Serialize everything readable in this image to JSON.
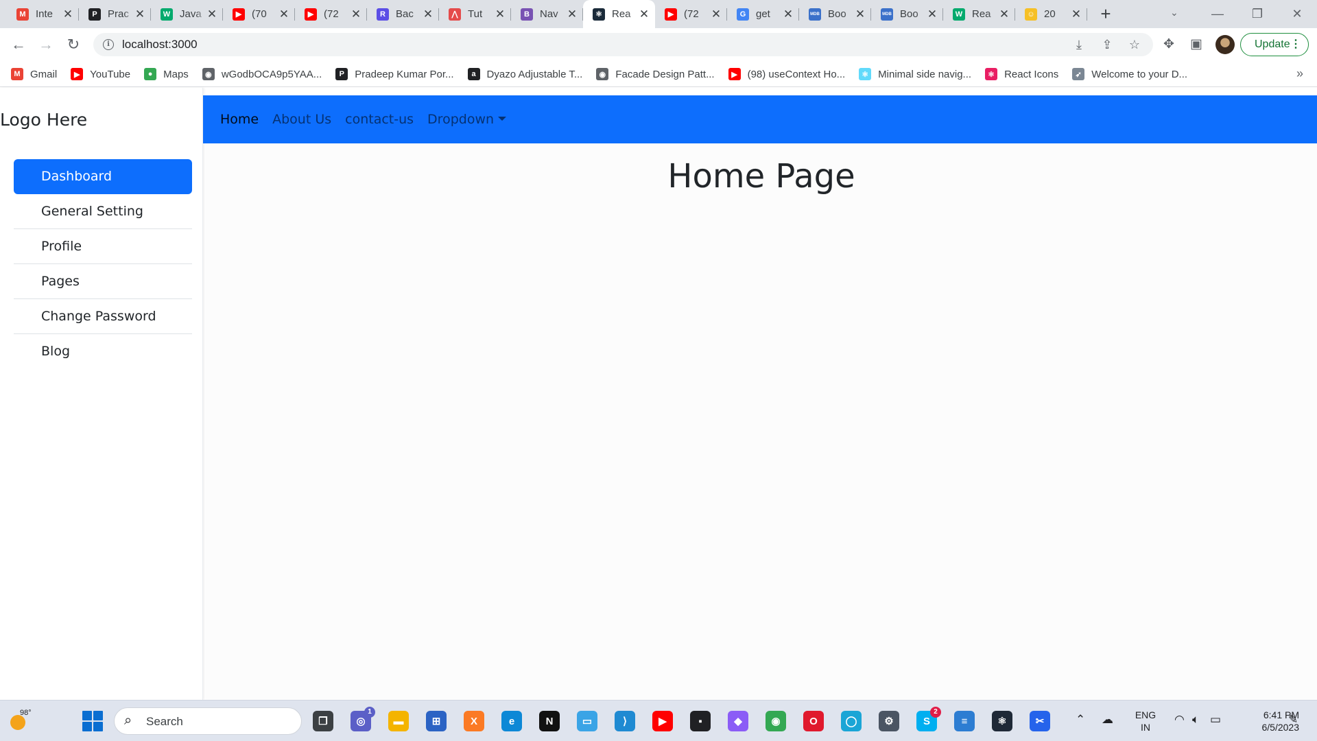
{
  "browser": {
    "tabs": [
      {
        "title": "Inte",
        "icon": "gmail-icon",
        "fav": "M",
        "color": "#ea4335",
        "active": false
      },
      {
        "title": "Prac",
        "icon": "p-logo-icon",
        "fav": "P",
        "color": "#202124",
        "active": false
      },
      {
        "title": "Java",
        "icon": "w3schools-icon",
        "fav": "W",
        "color": "#04aa6d",
        "active": false
      },
      {
        "title": "(70",
        "icon": "youtube-icon",
        "fav": "▶",
        "color": "#ff0000",
        "active": false
      },
      {
        "title": "(72",
        "icon": "youtube-icon",
        "fav": "▶",
        "color": "#ff0000",
        "active": false
      },
      {
        "title": "Bac",
        "icon": "r-app-icon",
        "fav": "R",
        "color": "#5b4ee6",
        "active": false
      },
      {
        "title": "Tut",
        "icon": "tutorial-icon",
        "fav": "⋀",
        "color": "#e54b4b",
        "active": false
      },
      {
        "title": "Nav",
        "icon": "bootstrap-icon",
        "fav": "B",
        "color": "#7952b3",
        "active": false
      },
      {
        "title": "Rea",
        "icon": "react-icon",
        "fav": "⚛",
        "color": "#1b2b3a",
        "active": true
      },
      {
        "title": "(72",
        "icon": "youtube-icon",
        "fav": "▶",
        "color": "#ff0000",
        "active": false
      },
      {
        "title": "get",
        "icon": "google-icon",
        "fav": "G",
        "color": "#4285f4",
        "active": false
      },
      {
        "title": "Boo",
        "icon": "mdb-icon",
        "fav": "MDB",
        "color": "#3b71ca",
        "active": false
      },
      {
        "title": "Boo",
        "icon": "mdb-icon",
        "fav": "MDB",
        "color": "#3b71ca",
        "active": false
      },
      {
        "title": "Rea",
        "icon": "w3schools-icon",
        "fav": "W",
        "color": "#04aa6d",
        "active": false
      },
      {
        "title": "20",
        "icon": "emoji-icon",
        "fav": "☺",
        "color": "#f6c026",
        "active": false
      }
    ],
    "url": "localhost:3000",
    "update_label": "Update",
    "bookmarks": [
      {
        "label": "Gmail",
        "icon": "gmail-icon",
        "fav": "M",
        "color": "#ea4335"
      },
      {
        "label": "YouTube",
        "icon": "youtube-icon",
        "fav": "▶",
        "color": "#ff0000"
      },
      {
        "label": "Maps",
        "icon": "maps-pin-icon",
        "fav": "●",
        "color": "#34a853"
      },
      {
        "label": "wGodbOCA9p5YAA...",
        "icon": "globe-icon",
        "fav": "◉",
        "color": "#5f6368"
      },
      {
        "label": "Pradeep Kumar Por...",
        "icon": "p-logo-icon",
        "fav": "P",
        "color": "#202124"
      },
      {
        "label": "Dyazo Adjustable T...",
        "icon": "amazon-icon",
        "fav": "a",
        "color": "#202124"
      },
      {
        "label": "Facade Design Patt...",
        "icon": "globe-icon",
        "fav": "◉",
        "color": "#5f6368"
      },
      {
        "label": "(98) useContext Ho...",
        "icon": "youtube-icon",
        "fav": "▶",
        "color": "#ff0000"
      },
      {
        "label": "Minimal side navig...",
        "icon": "react-icon",
        "fav": "⚛",
        "color": "#61dafb"
      },
      {
        "label": "React Icons",
        "icon": "react-icon",
        "fav": "⚛",
        "color": "#e91e63"
      },
      {
        "label": "Welcome to your D...",
        "icon": "rocket-icon",
        "fav": "➶",
        "color": "#7b8794"
      }
    ]
  },
  "app": {
    "logo": "Logo Here",
    "sidebar": [
      "Dashboard",
      "General Setting",
      "Profile",
      "Pages",
      "Change Password",
      "Blog"
    ],
    "nav": {
      "home": "Home",
      "about": "About Us",
      "contact": "contact-us",
      "dropdown": "Dropdown"
    },
    "title": "Home Page",
    "colors": {
      "primary": "#0d6efd"
    }
  },
  "taskbar": {
    "weather_temp": "98°",
    "search_placeholder": "Search",
    "apps": [
      {
        "icon": "task-view-icon",
        "fav": "❐",
        "color": "#3c4043"
      },
      {
        "icon": "teams-chat-icon",
        "fav": "◎",
        "color": "#5b5fc7",
        "badge": "1"
      },
      {
        "icon": "file-explorer-icon",
        "fav": "▬",
        "color": "#f4b400"
      },
      {
        "icon": "microsoft-store-icon",
        "fav": "⊞",
        "color": "#2b63c4"
      },
      {
        "icon": "xampp-icon",
        "fav": "X",
        "color": "#fb7a24"
      },
      {
        "icon": "edge-icon",
        "fav": "e",
        "color": "#0c88d6"
      },
      {
        "icon": "netflix-icon",
        "fav": "N",
        "color": "#111111"
      },
      {
        "icon": "sticky-app-icon",
        "fav": "▭",
        "color": "#3aa4e6"
      },
      {
        "icon": "vscode-icon",
        "fav": "⟩",
        "color": "#1f8ad2"
      },
      {
        "icon": "youtube-icon",
        "fav": "▶",
        "color": "#ff0000"
      },
      {
        "icon": "terminal-icon",
        "fav": "▪",
        "color": "#202124"
      },
      {
        "icon": "git-icon",
        "fav": "◆",
        "color": "#8b5cf6"
      },
      {
        "icon": "chrome-icon",
        "fav": "◉",
        "color": "#34a853"
      },
      {
        "icon": "opera-icon",
        "fav": "O",
        "color": "#e0192d"
      },
      {
        "icon": "alexa-icon",
        "fav": "◯",
        "color": "#1aa5d6"
      },
      {
        "icon": "settings-icon",
        "fav": "⚙",
        "color": "#4b5563"
      },
      {
        "icon": "skype-icon",
        "fav": "S",
        "color": "#00aff0",
        "badge": "2"
      },
      {
        "icon": "notepad-icon",
        "fav": "≡",
        "color": "#2d7dd2"
      },
      {
        "icon": "react-devtools-icon",
        "fav": "⚛",
        "color": "#1f2937"
      },
      {
        "icon": "snipping-tool-icon",
        "fav": "✂",
        "color": "#2563eb"
      }
    ],
    "lang": [
      "ENG",
      "IN"
    ],
    "time": "6:41 PM",
    "date": "6/5/2023"
  }
}
